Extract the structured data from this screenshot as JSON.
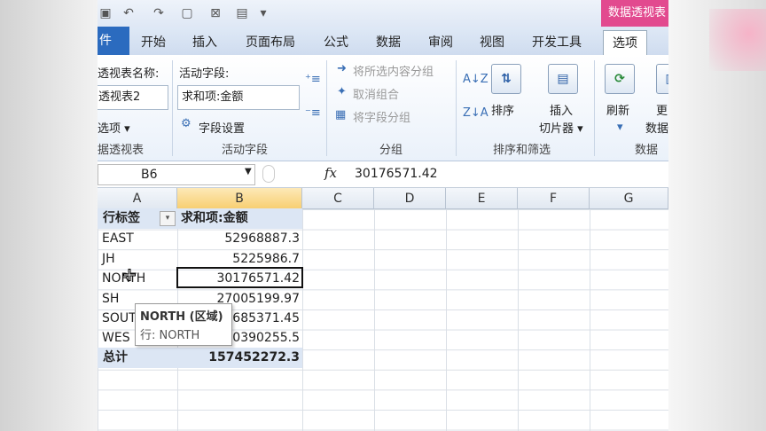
{
  "quick_access": {
    "icons": [
      "save-icon",
      "undo-icon",
      "redo-icon",
      "new-doc-icon",
      "close-icon",
      "print-preview-icon",
      "customize-icon"
    ]
  },
  "context_title": "数据透视表",
  "tabs": [
    "件",
    "开始",
    "插入",
    "页面布局",
    "公式",
    "数据",
    "审阅",
    "视图",
    "开发工具",
    "选项"
  ],
  "ribbon": {
    "pivot_name_label": "透视表名称:",
    "pivot_name_value": "透视表2",
    "options_label": "选项 ▾",
    "pivot_group_label": "据透视表",
    "active_field_label": "活动字段:",
    "active_field_value": "求和项:金额",
    "field_settings": "字段设置",
    "active_group_label": "活动字段",
    "group_selection": "将所选内容分组",
    "ungroup": "取消组合",
    "group_field": "将字段分组",
    "group_group_label": "分组",
    "sort_az": "A↓Z",
    "sort_za": "Z↓A",
    "sort_label": "排序",
    "insert_slicer_1": "插入",
    "insert_slicer_2": "切片器 ▾",
    "sort_group_label": "排序和筛选",
    "refresh": "刷新",
    "change_1": "更",
    "change_2": "数据",
    "data_group_label": "数据"
  },
  "formula_bar": {
    "name_box": "B6",
    "fx": "fx",
    "value": "30176571.42"
  },
  "columns": [
    "A",
    "B",
    "C",
    "D",
    "E",
    "F",
    "G"
  ],
  "pivot": {
    "header_label": "行标签",
    "header_value": "求和项:金额",
    "rows": [
      {
        "label": "EAST",
        "value": "52968887.3"
      },
      {
        "label": "JH",
        "value": "5225986.7"
      },
      {
        "label": "NORTH",
        "value": "30176571.42"
      },
      {
        "label": "SH",
        "value": "27005199.97"
      },
      {
        "label": "SOUT",
        "value": "685371.45"
      },
      {
        "label": "WES",
        "value": "0390255.5"
      }
    ],
    "total_label": "总计",
    "total_value": "157452272.3"
  },
  "tooltip": {
    "title": "NORTH (区域)",
    "body": "行: NORTH"
  },
  "colors": {
    "accent": "#2b6bbf",
    "context": "#e24a8f",
    "pivot_header": "#dce6f4"
  }
}
